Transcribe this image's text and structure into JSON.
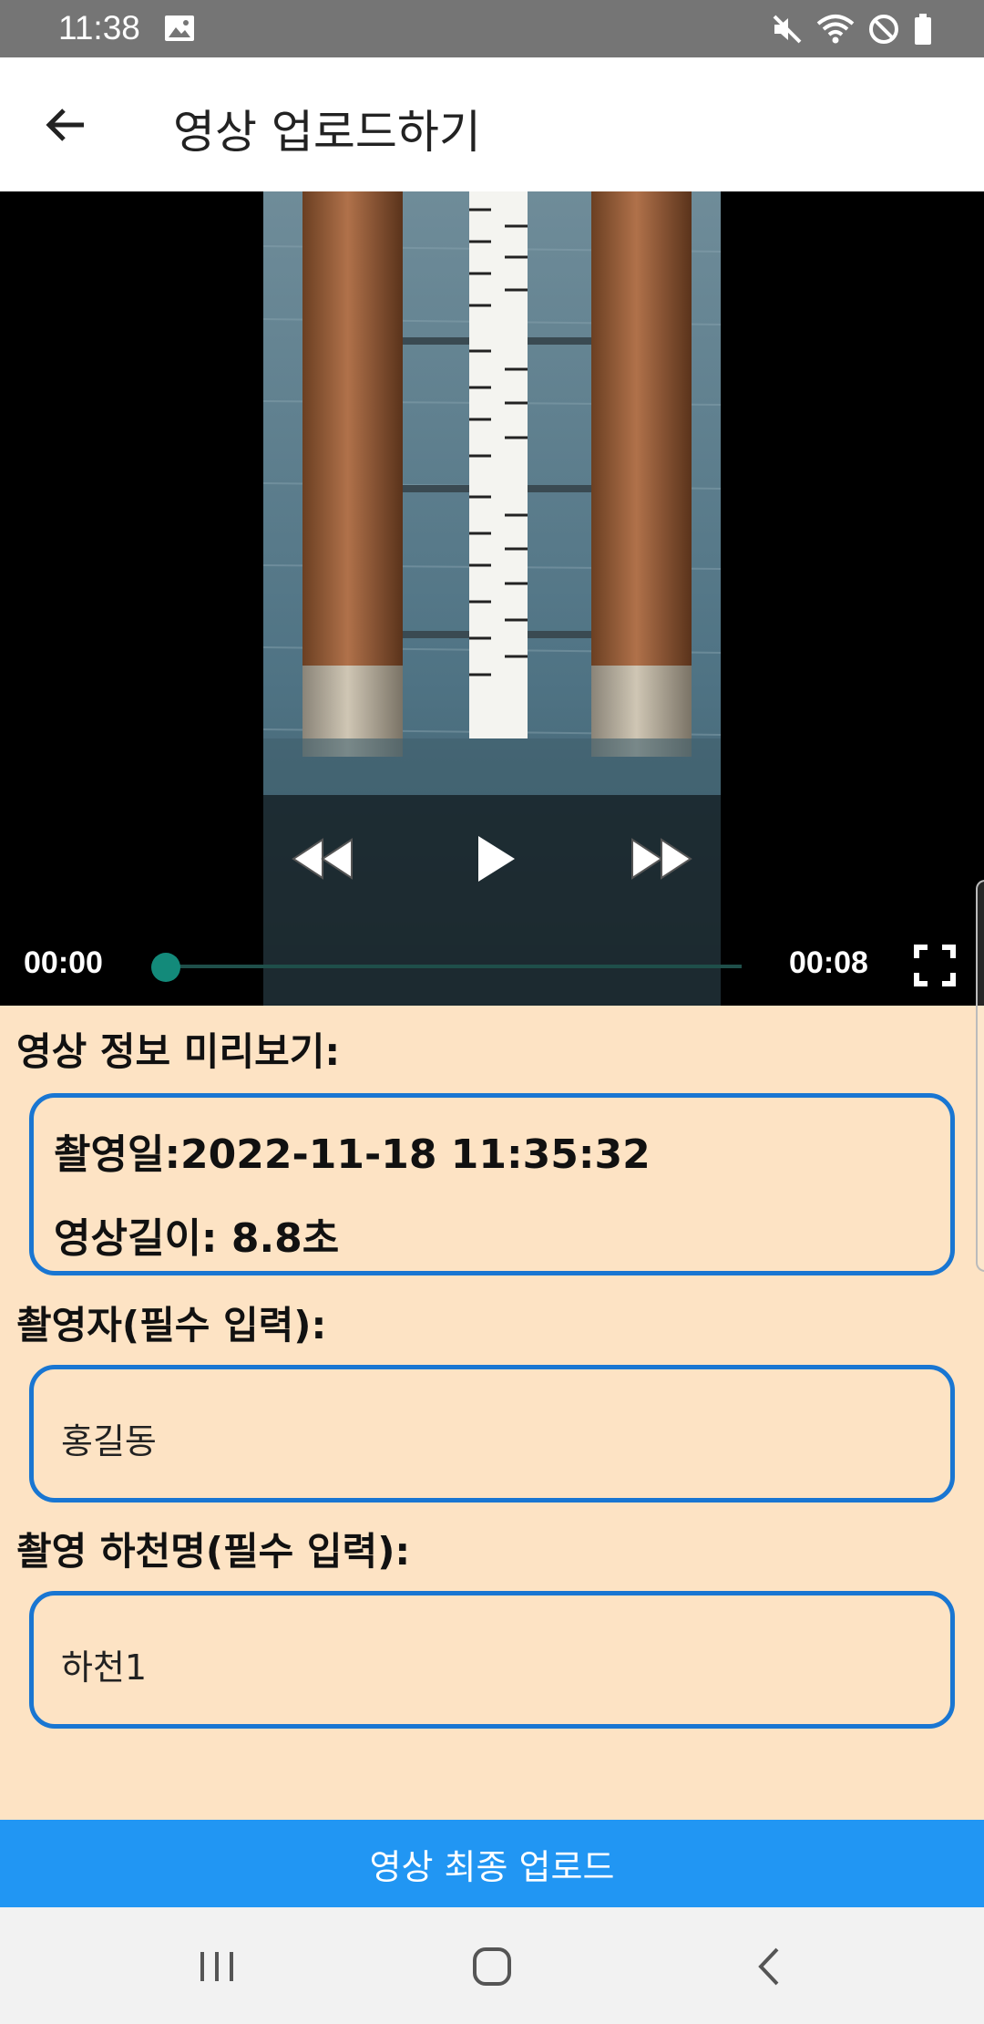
{
  "status_bar": {
    "time": "11:38",
    "icons": [
      "gallery-icon",
      "mute-icon",
      "wifi-icon",
      "do-not-disturb-icon",
      "battery-icon"
    ]
  },
  "app_bar": {
    "title": "영상 업로드하기",
    "back_icon": "arrow-left-icon"
  },
  "video_player": {
    "current_time": "00:00",
    "total_time": "00:08",
    "progress": 0,
    "controls": [
      "rewind-icon",
      "play-icon",
      "fast-forward-icon",
      "fullscreen-icon"
    ]
  },
  "preview": {
    "label": "영상 정보 미리보기:",
    "capture_date": "촬영일:2022-11-18 11:35:32",
    "duration": "영상길이: 8.8초"
  },
  "photographer": {
    "label": "촬영자(필수 입력):",
    "value": "홍길동"
  },
  "river": {
    "label": "촬영 하천명(필수 입력):",
    "value": "하천1"
  },
  "upload_button": {
    "label": "영상 최종 업로드"
  },
  "colors": {
    "background": "#fde3c4",
    "accent": "#2196f3",
    "border": "#1976d2",
    "status_bar": "#757575",
    "progress_thumb": "#138a7a"
  }
}
